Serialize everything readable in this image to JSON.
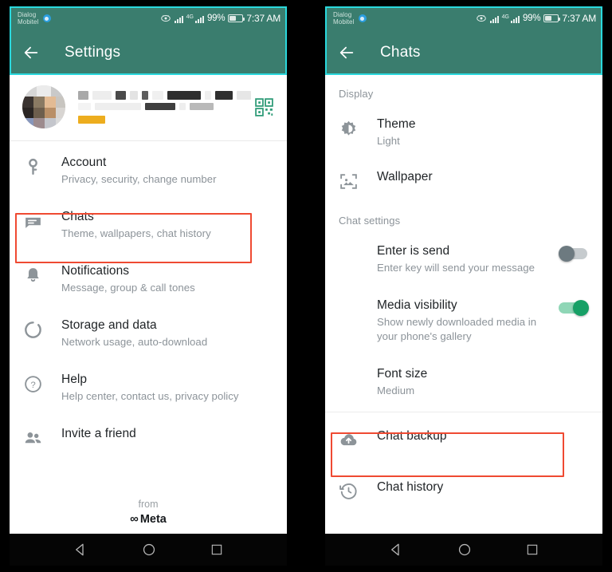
{
  "meta": {
    "accent_green": "#3a7d6e",
    "highlight_red": "#ef4a32",
    "selection_cyan": "#2ad8dd",
    "toggle_on_color": "#17a066",
    "qr_icon_color": "#2e9b77"
  },
  "status_bar": {
    "carrier_line1": "Dialog",
    "carrier_line2": "Mobitel",
    "network": "4G",
    "battery_percent": "99%",
    "clock": "7:37 AM",
    "icons": [
      "eye-icon",
      "signal-bars-icon",
      "signal-bars-icon",
      "battery-icon"
    ]
  },
  "left_screen": {
    "appbar": {
      "title": "Settings",
      "back_icon": "back-arrow-icon"
    },
    "profile": {
      "avatar": "profile-avatar-pixelated",
      "name_redacted": true,
      "status_redacted": true,
      "qr_icon": "qr-code-icon"
    },
    "items": [
      {
        "icon": "key-icon",
        "title": "Account",
        "subtitle": "Privacy, security, change number",
        "highlighted": false
      },
      {
        "icon": "chat-bubble-icon",
        "title": "Chats",
        "subtitle": "Theme, wallpapers, chat history",
        "highlighted": true
      },
      {
        "icon": "bell-icon",
        "title": "Notifications",
        "subtitle": "Message, group & call tones",
        "highlighted": false
      },
      {
        "icon": "data-usage-icon",
        "title": "Storage and data",
        "subtitle": "Network usage, auto-download",
        "highlighted": false
      },
      {
        "icon": "help-circle-icon",
        "title": "Help",
        "subtitle": "Help center, contact us, privacy policy",
        "highlighted": false
      },
      {
        "icon": "people-icon",
        "title": "Invite a friend",
        "subtitle": "",
        "highlighted": false
      }
    ],
    "footer": {
      "from_label": "from",
      "brand": "Meta",
      "brand_glyph": "∞"
    }
  },
  "right_screen": {
    "appbar": {
      "title": "Chats",
      "back_icon": "back-arrow-icon"
    },
    "sections": [
      {
        "header": "Display",
        "items": [
          {
            "icon": "brightness-icon",
            "title": "Theme",
            "subtitle": "Light",
            "control": "none",
            "highlighted": false
          },
          {
            "icon": "wallpaper-icon",
            "title": "Wallpaper",
            "subtitle": "",
            "control": "none",
            "highlighted": false
          }
        ]
      },
      {
        "header": "Chat settings",
        "items": [
          {
            "icon": "none",
            "title": "Enter is send",
            "subtitle": "Enter key will send your message",
            "control": "toggle",
            "toggle_state": "off",
            "highlighted": false
          },
          {
            "icon": "none",
            "title": "Media visibility",
            "subtitle": "Show newly downloaded media in your phone's gallery",
            "control": "toggle",
            "toggle_state": "on",
            "highlighted": false
          },
          {
            "icon": "none",
            "title": "Font size",
            "subtitle": "Medium",
            "control": "none",
            "highlighted": false
          }
        ]
      },
      {
        "header": "",
        "items": [
          {
            "icon": "cloud-upload-icon",
            "title": "Chat backup",
            "subtitle": "",
            "control": "none",
            "highlighted": true
          },
          {
            "icon": "history-clock-icon",
            "title": "Chat history",
            "subtitle": "",
            "control": "none",
            "highlighted": false
          }
        ]
      }
    ]
  },
  "nav_bar": {
    "back": "android-back-icon",
    "home": "android-home-icon",
    "recents": "android-recents-icon"
  }
}
